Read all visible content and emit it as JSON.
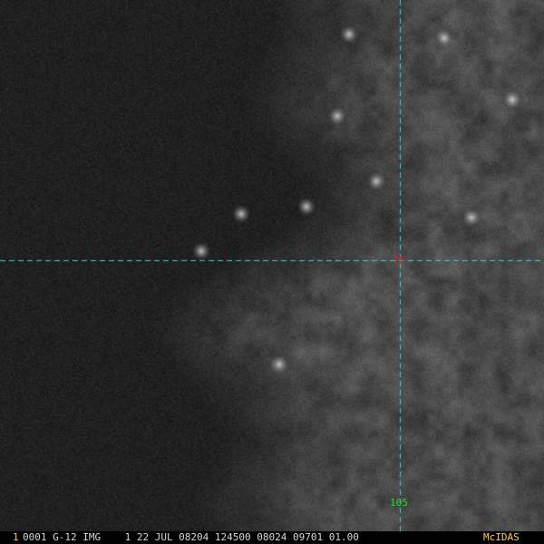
{
  "image": {
    "description_hidden": "",
    "background": "#1e1e1e"
  },
  "grid": {
    "line_color": "#2fd3d3",
    "latitude_label": "15",
    "latitude_label_color": "#e02020",
    "longitude_label": "105",
    "longitude_label_color": "#22dd22"
  },
  "status_bar": {
    "frame_number": "1",
    "frame_number_color": "#ffd23a",
    "text": "0001 G-12 IMG    1 22 JUL 08204 124500 08024 09701 01.00",
    "text_color": "#d8d8d8",
    "software": "McIDAS",
    "software_color": "#ffd23a"
  }
}
